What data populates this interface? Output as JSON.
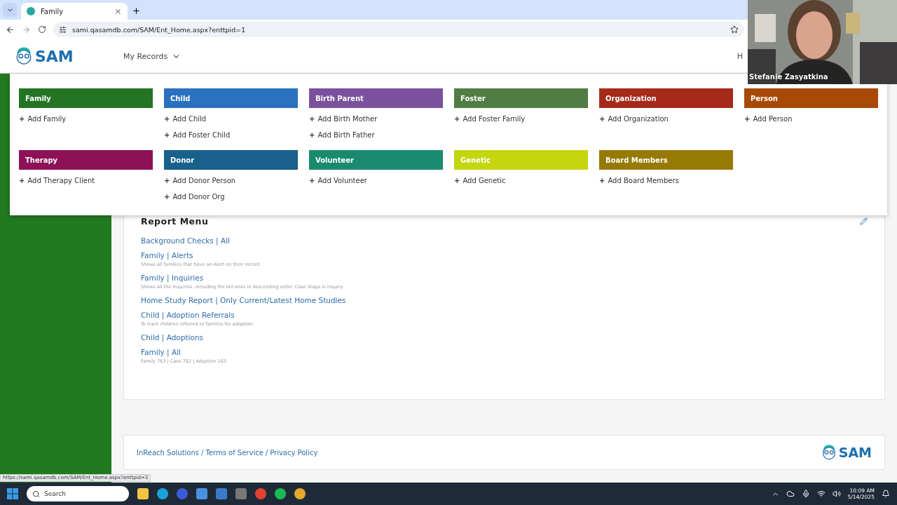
{
  "browser": {
    "tab_title": "Family",
    "address": "sami.qasamdb.com/SAM/Ent_Home.aspx?enttpid=1",
    "status_url": "https://sami.qasamdb.com/SAM/Ent_Home.aspx?enttpid=3"
  },
  "header": {
    "logo": "SAM",
    "nav": "My Records",
    "cut_text": "H"
  },
  "menu": [
    {
      "title": "Family",
      "color": "#237423",
      "actions": [
        "Add Family"
      ]
    },
    {
      "title": "Child",
      "color": "#2a72c0",
      "actions": [
        "Add Child",
        "Add Foster Child"
      ]
    },
    {
      "title": "Birth Parent",
      "color": "#7b519d",
      "actions": [
        "Add Birth Mother",
        "Add Birth Father"
      ]
    },
    {
      "title": "Foster",
      "color": "#507d43",
      "actions": [
        "Add Foster Family"
      ]
    },
    {
      "title": "Organization",
      "color": "#a52a1a",
      "actions": [
        "Add Organization"
      ]
    },
    {
      "title": "Person",
      "color": "#a84a05",
      "actions": [
        "Add Person"
      ]
    },
    {
      "title": "Therapy",
      "color": "#8e1158",
      "actions": [
        "Add Therapy Client"
      ]
    },
    {
      "title": "Donor",
      "color": "#17618a",
      "actions": [
        "Add Donor Person",
        "Add Donor Org"
      ]
    },
    {
      "title": "Volunteer",
      "color": "#1a8a6e",
      "actions": [
        "Add Volunteer"
      ]
    },
    {
      "title": "Genetic",
      "color": "#c4d60e",
      "actions": [
        "Add Genetic"
      ]
    },
    {
      "title": "Board Members",
      "color": "#957a06",
      "actions": [
        "Add Board Members"
      ]
    }
  ],
  "plus_sign": "+",
  "report_menu": {
    "title": "Report Menu",
    "reports": [
      {
        "title": "Background Checks | All"
      },
      {
        "title": "Family | Alerts",
        "description": "Shows all families that have an Alert on their record."
      },
      {
        "title": "Family | Inquiries",
        "description": "Shows all the Inquiries, including the old ones in descending order. Case Stage is Inquiry."
      },
      {
        "title": "Home Study Report | Only Current/Latest Home Studies"
      },
      {
        "title": "Child | Adoption Referrals",
        "description": "To track children referred to families for adoption."
      },
      {
        "title": "Child | Adoptions"
      },
      {
        "title": "Family | All",
        "description": "Family 763 | Case 782 | Adoption 163"
      }
    ]
  },
  "footer": {
    "links": [
      "InReach Solutions",
      "Terms of Service",
      "Privacy Policy"
    ],
    "separator": "/",
    "logo": "SAM"
  },
  "video": {
    "name": "Stefanie Zasyatkina"
  },
  "taskbar": {
    "search_placeholder": "Search",
    "time": "10:09 AM",
    "date": "5/14/2025"
  }
}
